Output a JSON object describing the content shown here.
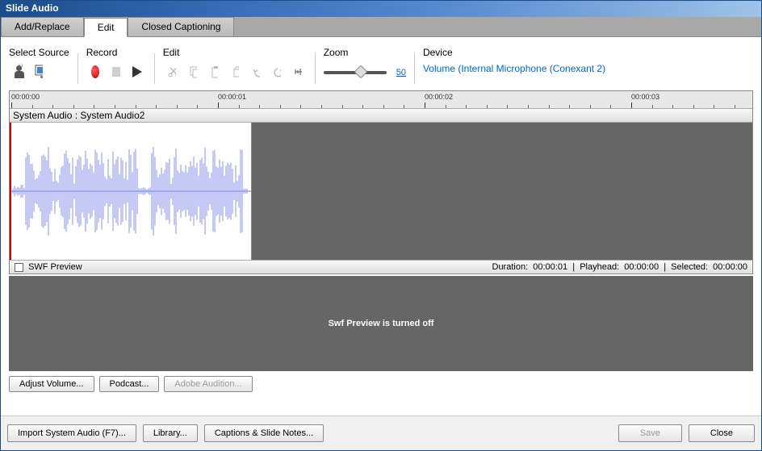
{
  "window": {
    "title": "Slide Audio"
  },
  "tabs": {
    "add_replace": "Add/Replace",
    "edit": "Edit",
    "closed_captioning": "Closed Captioning",
    "active": "edit"
  },
  "toolbar": {
    "select_source": {
      "label": "Select Source"
    },
    "record": {
      "label": "Record"
    },
    "edit": {
      "label": "Edit"
    },
    "zoom": {
      "label": "Zoom",
      "value": "50"
    },
    "device": {
      "label": "Device",
      "link": "Volume (Internal Microphone (Conexant 2)"
    }
  },
  "timeline": {
    "ticks": [
      "00:00:00",
      "00:00:01",
      "00:00:02",
      "00:00:03"
    ],
    "track_name": "System Audio : System Audio2"
  },
  "status": {
    "swf_preview_label": "SWF Preview",
    "duration_label": "Duration:",
    "duration": "00:00:01",
    "playhead_label": "Playhead:",
    "playhead": "00:00:00",
    "selected_label": "Selected:",
    "selected": "00:00:00"
  },
  "swf_message": "Swf Preview is turned off",
  "buttons": {
    "adjust_volume": "Adjust Volume...",
    "podcast": "Podcast...",
    "adobe_audition": "Adobe Audition...",
    "import_system_audio": "Import System Audio (F7)...",
    "library": "Library...",
    "captions_notes": "Captions & Slide Notes...",
    "save": "Save",
    "close": "Close"
  }
}
